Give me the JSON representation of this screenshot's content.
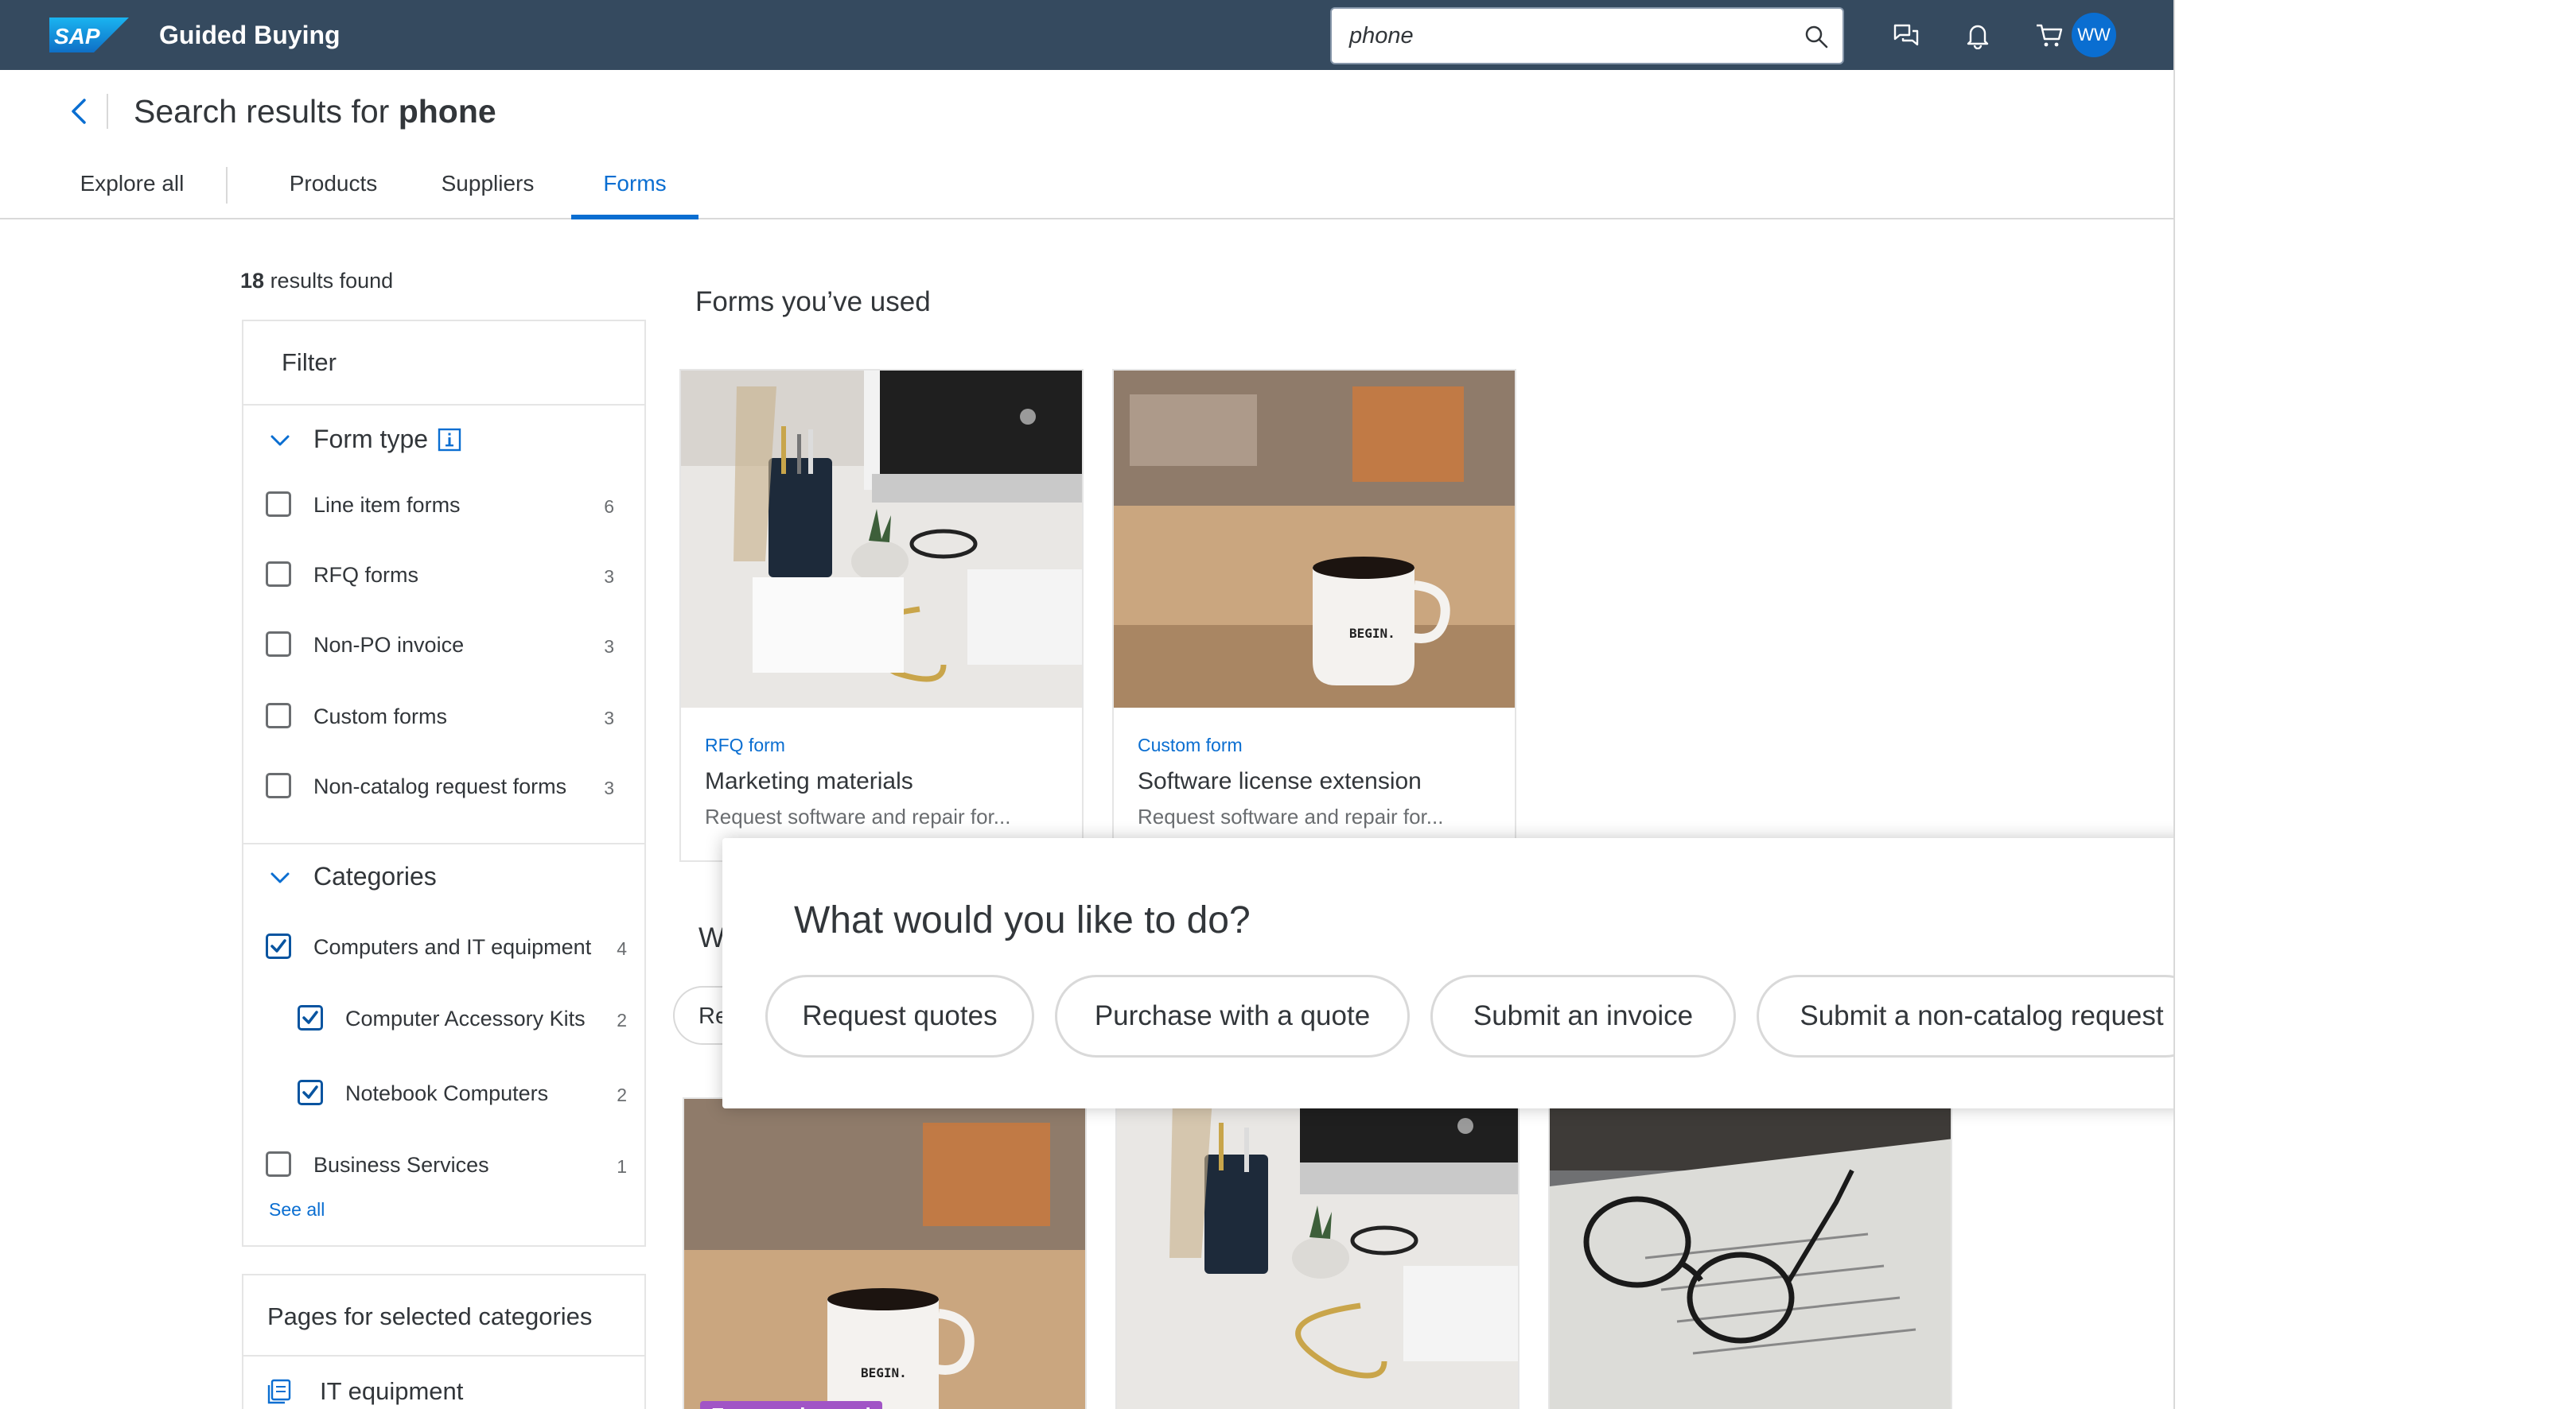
{
  "shell": {
    "app_title": "Guided Buying",
    "search_value": "phone",
    "avatar_initials": "WW"
  },
  "header": {
    "title_prefix": "Search results for",
    "title_query": "phone"
  },
  "tabs": [
    {
      "label": "Explore all"
    },
    {
      "label": "Products"
    },
    {
      "label": "Suppliers"
    },
    {
      "label": "Forms"
    }
  ],
  "results": {
    "count": "18",
    "suffix": "results found"
  },
  "filter": {
    "title": "Filter",
    "form_type": {
      "title": "Form type",
      "options": [
        {
          "label": "Line item forms",
          "count": "6",
          "checked": false
        },
        {
          "label": "RFQ forms",
          "count": "3",
          "checked": false
        },
        {
          "label": "Non-PO invoice",
          "count": "3",
          "checked": false
        },
        {
          "label": "Custom forms",
          "count": "3",
          "checked": false
        },
        {
          "label": "Non-catalog request forms",
          "count": "3",
          "checked": false
        }
      ]
    },
    "categories": {
      "title": "Categories",
      "options": [
        {
          "label": "Computers and IT equipment",
          "count": "4",
          "checked": true
        },
        {
          "label": "Computer Accessory Kits",
          "count": "2",
          "checked": true
        },
        {
          "label": "Notebook Computers",
          "count": "2",
          "checked": true
        },
        {
          "label": "Business Services",
          "count": "1",
          "checked": false
        }
      ],
      "see_all": "See all"
    }
  },
  "pages_panel": {
    "title": "Pages for selected categories",
    "link": "IT equipment"
  },
  "forms_used": {
    "heading": "Forms you’ve used",
    "cards": [
      {
        "type": "RFQ form",
        "title": "Marketing materials",
        "desc": "Request software and repair for..."
      },
      {
        "type": "Custom form",
        "title": "Software license extension",
        "desc": "Request software and repair for..."
      }
    ]
  },
  "background_section": {
    "heading_fragment": "W",
    "pill_fragment": "Re",
    "badge": "Frequently used"
  },
  "popover": {
    "title": "What would you like to do?",
    "actions": [
      {
        "label": "Request quotes"
      },
      {
        "label": "Purchase with a quote"
      },
      {
        "label": "Submit an invoice"
      },
      {
        "label": "Submit a non-catalog request"
      }
    ]
  },
  "colors": {
    "shell": "#354a5f",
    "accent": "#0a6ed1",
    "badge": "#a154c6"
  }
}
